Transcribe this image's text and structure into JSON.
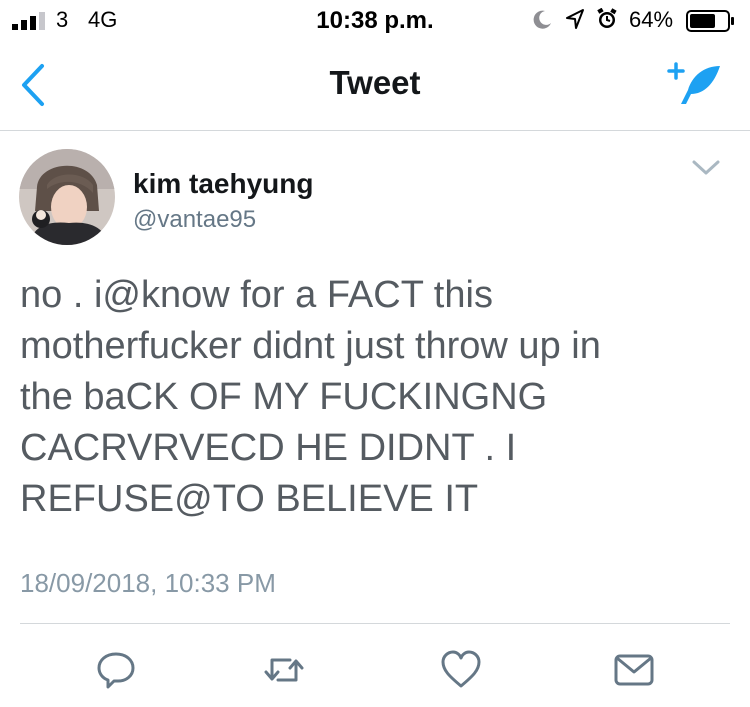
{
  "status_bar": {
    "carrier": "3",
    "network": "4G",
    "time": "10:38 p.m.",
    "battery": "64%",
    "icons": [
      "signal-icon",
      "moon-icon",
      "location-icon",
      "alarm-icon",
      "battery-icon"
    ]
  },
  "nav": {
    "title": "Tweet",
    "icons": [
      "back-chevron-icon",
      "compose-tweet-icon"
    ],
    "accent_color": "#1da1f2"
  },
  "tweet": {
    "author_name": "kim taehyung",
    "author_handle": "@vantae95",
    "body": "no . i@know for a FACT this\nmotherfucker didnt just throw up in\nthe baCK OF MY FUCKINGNG\nCACRVRVECD HE DIDNT . I\nREFUSE@TO BELIEVE IT",
    "timestamp": "18/09/2018, 10:33 PM",
    "actions": [
      "reply-icon",
      "retweet-icon",
      "like-icon",
      "dm-icon"
    ]
  }
}
